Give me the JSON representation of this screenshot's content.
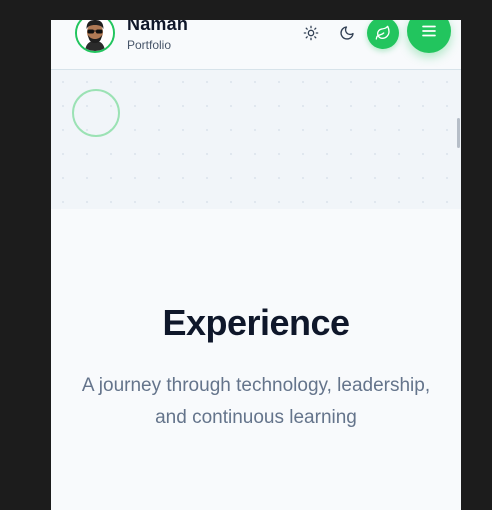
{
  "header": {
    "name": "Naman",
    "subtitle": "Portfolio",
    "icons": {
      "theme_light": "sun-icon",
      "theme_dark": "moon-icon",
      "theme_green": "leaf-icon",
      "menu": "menu-icon"
    }
  },
  "section": {
    "title": "Experience",
    "subtitle": "A journey through technology, leadership, and continuous learning"
  },
  "colors": {
    "accent": "#22c55e",
    "heading": "#0f172a",
    "muted": "#64748b"
  }
}
